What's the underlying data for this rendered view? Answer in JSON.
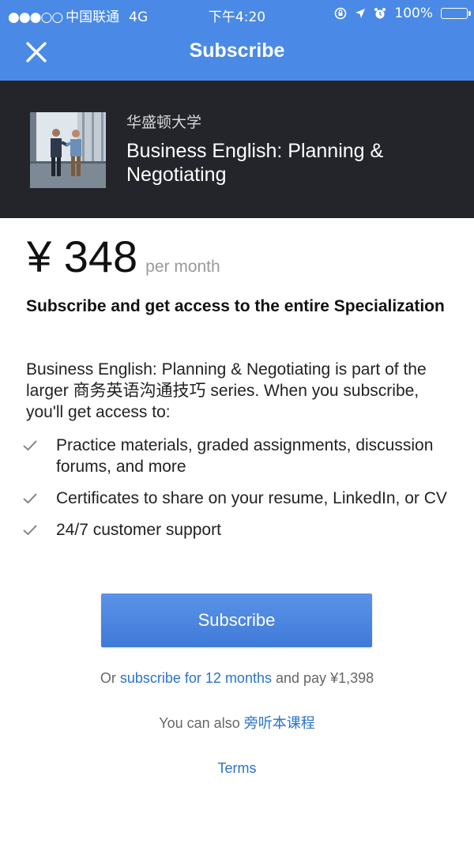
{
  "status_bar": {
    "signal": "●●●○○",
    "carrier": "中国联通",
    "network": "4G",
    "time": "下午4:20",
    "battery": "100%",
    "battery_level": 1.0
  },
  "nav": {
    "title": "Subscribe",
    "close_icon": "close-icon"
  },
  "course": {
    "university": "华盛顿大学",
    "title": "Business English: Planning & Negotiating",
    "thumbnail": "handshake-photo"
  },
  "pricing": {
    "amount": "¥ 348",
    "period": "per month"
  },
  "headline": "Subscribe and get access to the entire Specialization",
  "description": "Business English: Planning & Negotiating is part of the larger 商务英语沟通技巧 series. When you subscribe, you'll get access to:",
  "benefits": [
    "Practice materials, graded assignments, discussion forums, and more",
    "Certificates to share on your resume, LinkedIn, or CV",
    "24/7 customer support"
  ],
  "subscribe_button": "Subscribe",
  "annual": {
    "prefix": "Or",
    "link": "subscribe for 12 months",
    "middle": "and pay",
    "price": "¥1,398"
  },
  "audit": {
    "prefix": "You can also",
    "link": "旁听本课程"
  },
  "terms": "Terms",
  "colors": {
    "nav_bg": "#4a8ae6",
    "header_bg": "#23252b",
    "button": "#4a86e0",
    "link": "#2a73cc"
  }
}
